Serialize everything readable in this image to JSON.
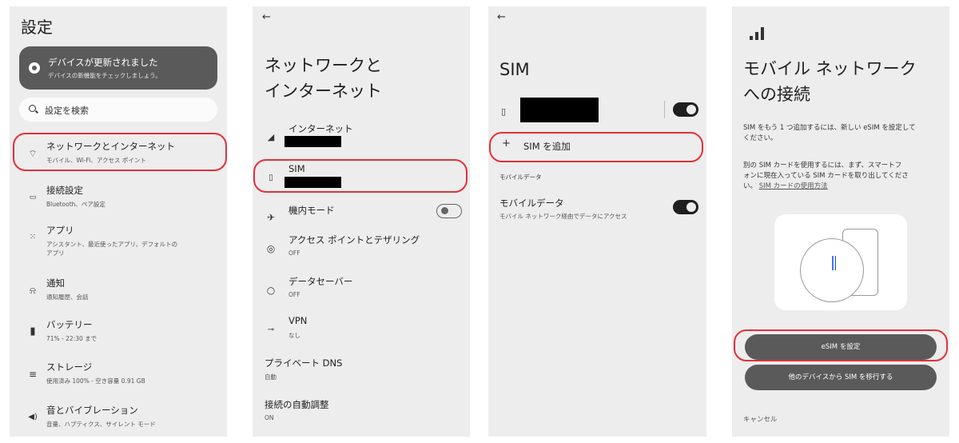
{
  "panel1": {
    "title": "設定",
    "banner": {
      "title": "デバイスが更新されました",
      "subtitle": "デバイスの新機能をチェックしましょう。"
    },
    "search": {
      "label": "設定を検索"
    },
    "items": [
      {
        "title": "ネットワークとインターネット",
        "subtitle": "モバイル、Wi-Fi、アクセス ポイント",
        "icon": "wifi-icon"
      },
      {
        "title": "接続設定",
        "subtitle": "Bluetooth、ペア設定",
        "icon": "connected-devices-icon"
      },
      {
        "title": "アプリ",
        "subtitle": "アシスタント、最近使ったアプリ、デフォルトのアプリ",
        "icon": "apps-grid-icon"
      },
      {
        "title": "通知",
        "subtitle": "通知履歴、会話",
        "icon": "bell-icon"
      },
      {
        "title": "バッテリー",
        "subtitle": "71% - 22:30 まで",
        "icon": "battery-icon"
      },
      {
        "title": "ストレージ",
        "subtitle": "使用済み 100% - 空き容量 0.91 GB",
        "icon": "storage-icon"
      },
      {
        "title": "音とバイブレーション",
        "subtitle": "音量、ハプティクス、サイレント モード",
        "icon": "speaker-icon"
      }
    ]
  },
  "panel2": {
    "back_glyph": "←",
    "title_line1": "ネットワークと",
    "title_line2": "インターネット",
    "items": [
      {
        "title": "インターネット",
        "subtitle": "",
        "icon": "signal-icon"
      },
      {
        "title": "SIM",
        "subtitle": "",
        "icon": "sim-card-icon"
      },
      {
        "title": "機内モード",
        "subtitle": "",
        "icon": "airplane-icon",
        "toggle": "off"
      },
      {
        "title": "アクセス ポイントとテザリング",
        "subtitle": "OFF",
        "icon": "hotspot-icon"
      },
      {
        "title": "データセーバー",
        "subtitle": "OFF",
        "icon": "data-saver-icon"
      },
      {
        "title": "VPN",
        "subtitle": "なし",
        "icon": "vpn-key-icon"
      },
      {
        "title": "プライベート DNS",
        "subtitle": "自動"
      },
      {
        "title": "接続の自動調整",
        "subtitle": "ON"
      }
    ]
  },
  "panel3": {
    "back_glyph": "←",
    "title": "SIM",
    "sim_toggle": "on",
    "add_sim": {
      "plus": "+",
      "label": "SIM を追加"
    },
    "section": "モバイルデータ",
    "mobile_data": {
      "title": "モバイルデータ",
      "subtitle": "モバイル ネットワーク経由でデータにアクセス",
      "toggle": "on"
    }
  },
  "panel4": {
    "title_line1": "モバイル ネットワーク",
    "title_line2": "への接続",
    "para1_line1": "SIM をもう 1 つ追加するには、新しい eSIM を設定して",
    "para1_line2": "ください。",
    "para2_line1": "別の SIM カードを使用するには、まず、スマートフ",
    "para2_line2": "ォンに現在入っている SIM カードを取り出してくださ",
    "para2_line3_prefix": "い。",
    "para2_link": "SIM カードの使用方法",
    "btn_esim": "eSIM を設定",
    "btn_transfer": "他のデバイスから SIM を移行する",
    "cancel": "キャンセル"
  },
  "highlight_color": "#e0313a"
}
